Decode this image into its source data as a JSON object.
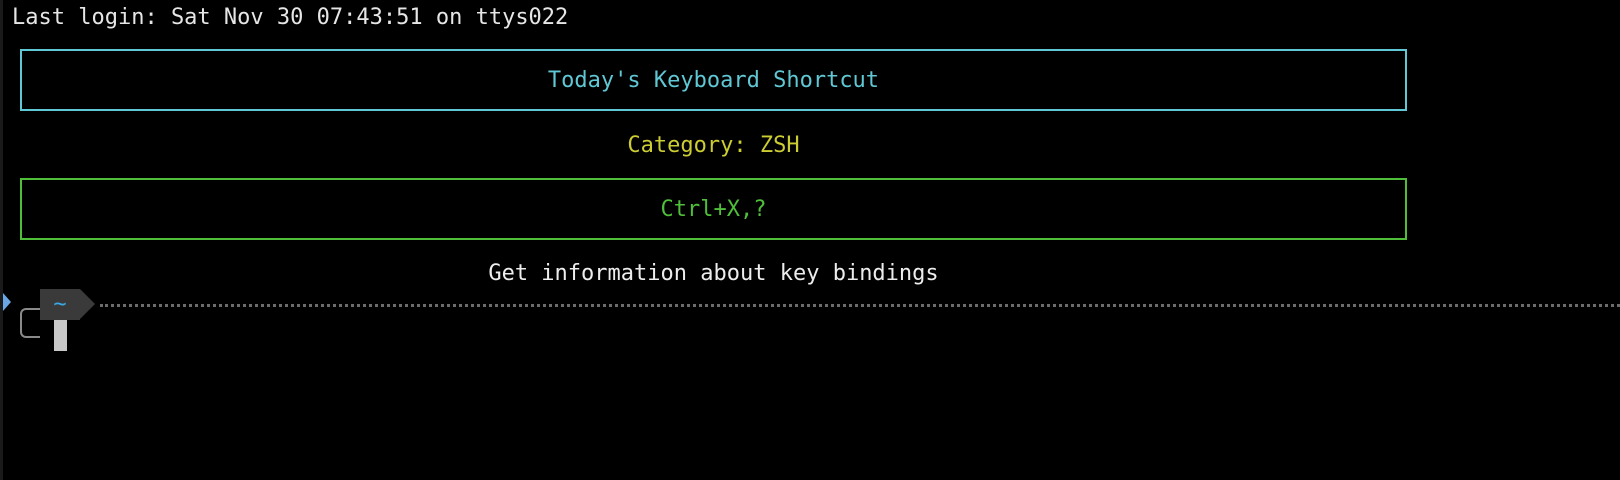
{
  "terminal": {
    "login_line": "Last login: Sat Nov 30 07:43:51 on ttys022",
    "title": "Today's Keyboard Shortcut",
    "category_label": "Category: ZSH",
    "shortcut": "Ctrl+X,?",
    "description": "Get information about key bindings",
    "prompt_path": "~"
  },
  "colors": {
    "background": "#000000",
    "title": "#5fc8d4",
    "category": "#cccc33",
    "shortcut": "#4fbf3a",
    "description": "#ededed",
    "prompt_path": "#3aa8e6",
    "prompt_segment_bg": "#3a3a3a"
  },
  "icons": {
    "prompt_marker": "triangle-right-icon",
    "prompt_segment_arrow": "powerline-arrow-icon"
  }
}
